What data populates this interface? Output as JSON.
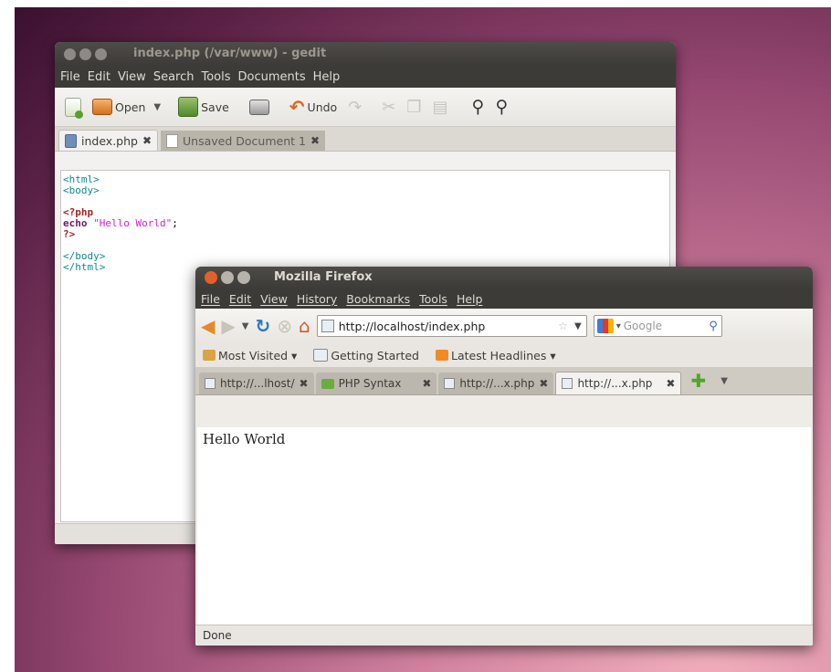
{
  "gedit": {
    "title": "index.php (/var/www) - gedit",
    "menu": [
      "File",
      "Edit",
      "View",
      "Search",
      "Tools",
      "Documents",
      "Help"
    ],
    "toolbar": {
      "open_label": "Open",
      "save_label": "Save",
      "undo_label": "Undo"
    },
    "tabs": [
      {
        "label": "index.php",
        "close": "✖"
      },
      {
        "label": "Unsaved Document 1",
        "close": "✖"
      }
    ],
    "code": {
      "l1": "<html>",
      "l2": "<body>",
      "l3": "<?php",
      "l4_kw": "echo",
      "l4_str": "\"Hello World\"",
      "l4_end": ";",
      "l5": "?>",
      "l6": "</body>",
      "l7": "</html>"
    }
  },
  "firefox": {
    "title": "Mozilla Firefox",
    "menu": [
      "File",
      "Edit",
      "View",
      "History",
      "Bookmarks",
      "Tools",
      "Help"
    ],
    "url": "http://localhost/index.php",
    "search_placeholder": "Google",
    "bookmarks": [
      "Most Visited ▾",
      "Getting Started",
      "Latest Headlines ▾"
    ],
    "tabs": [
      {
        "label": "http://...lhost/",
        "close": "✖"
      },
      {
        "label": "PHP Syntax",
        "close": "✖"
      },
      {
        "label": "http://...x.php",
        "close": "✖"
      },
      {
        "label": "http://...x.php",
        "close": "✖"
      }
    ],
    "content_text": "Hello World",
    "status": "Done"
  },
  "colors": {
    "title_bar": "#3c3b37",
    "desktop_mid": "#9a4b74",
    "firefox_close_button": "#e3602a"
  }
}
